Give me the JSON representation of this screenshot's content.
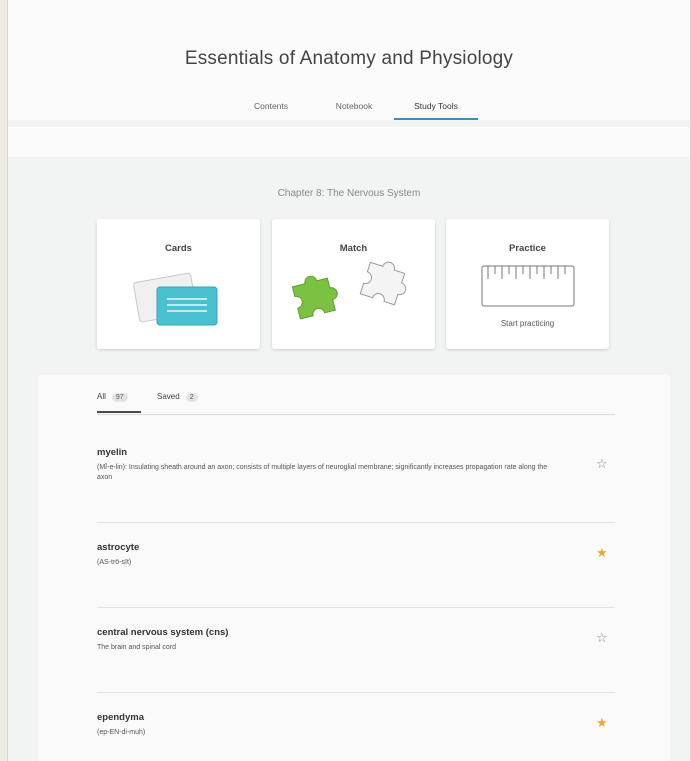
{
  "book": {
    "title": "Essentials of Anatomy and Physiology"
  },
  "tabs": [
    {
      "label": "Contents",
      "active": false
    },
    {
      "label": "Notebook",
      "active": false
    },
    {
      "label": "Study Tools",
      "active": true
    }
  ],
  "chapter": "Chapter 8: The Nervous System",
  "tools": [
    {
      "title": "Cards",
      "subtitle": "",
      "icon": "flashcards-icon"
    },
    {
      "title": "Match",
      "subtitle": "",
      "icon": "puzzle-icon"
    },
    {
      "title": "Practice",
      "subtitle": "Start practicing",
      "icon": "ruler-icon"
    }
  ],
  "filters": {
    "all": {
      "label": "All",
      "count": "97",
      "active": true
    },
    "saved": {
      "label": "Saved",
      "count": "2",
      "active": false
    }
  },
  "terms": [
    {
      "term": "myelin",
      "definition": "(MĪ-e-lin): Insulating sheath around an axon; consists of multiple layers of neuroglial membrane; significantly increases propagation rate along the axon",
      "saved": false
    },
    {
      "term": "astrocyte",
      "definition": "(AS-trō-sīt)",
      "saved": true
    },
    {
      "term": "central nervous system (cns)",
      "definition": "The brain and spinal cord",
      "saved": false
    },
    {
      "term": "ependyma",
      "definition": "(ep-EN-di-muh)",
      "saved": true
    }
  ],
  "colors": {
    "accent": "#3d8fb8",
    "star_saved": "#f0a825",
    "star_unsaved": "#8a8a8a",
    "match_piece_green": "#7cc242",
    "cards_teal": "#49c1d0"
  }
}
